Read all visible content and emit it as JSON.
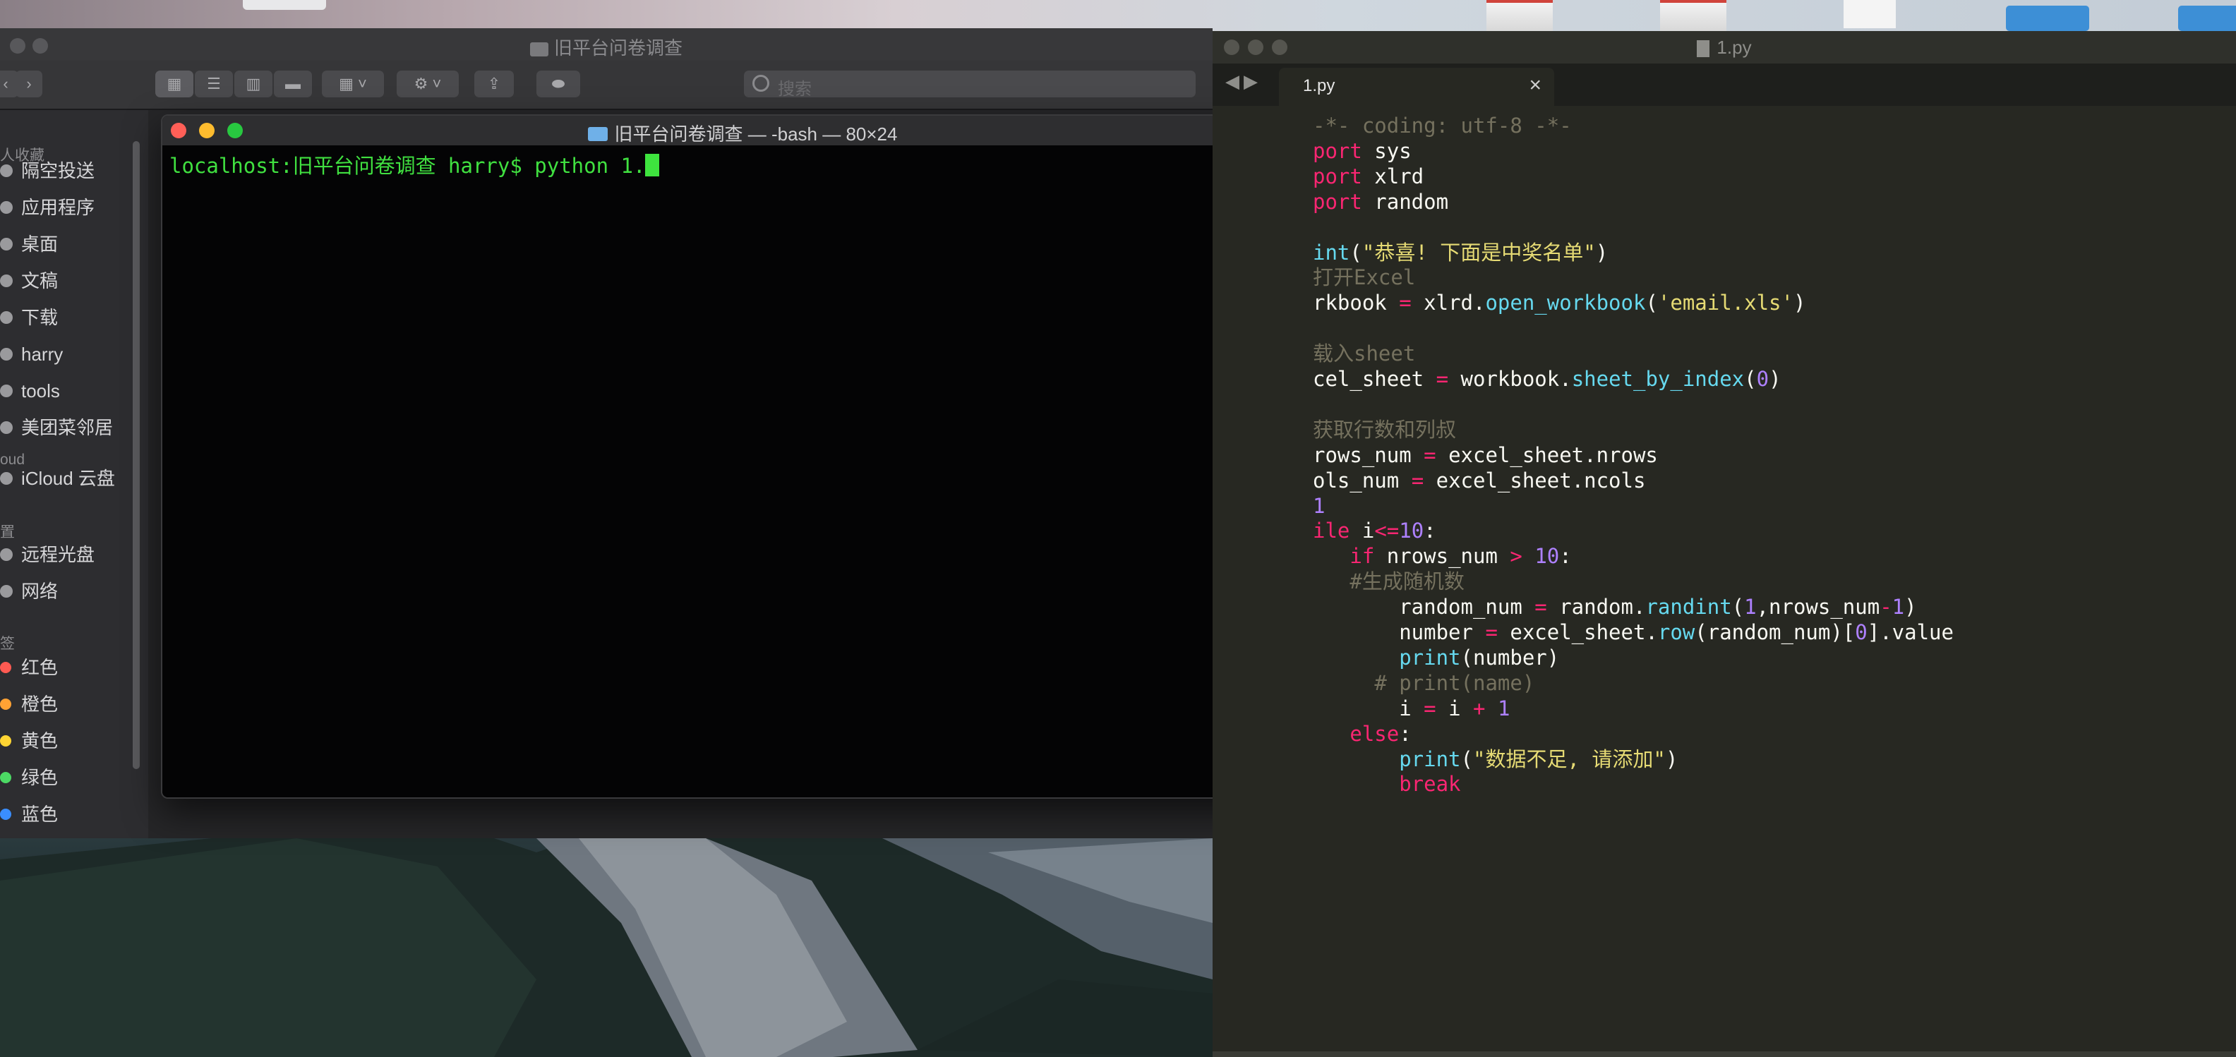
{
  "finder": {
    "title": "旧平台问卷调查",
    "search_placeholder": "搜索",
    "sidebar": {
      "favorites_header": "人收藏",
      "items": [
        {
          "label": "隔空投送",
          "icon": "airdrop-icon"
        },
        {
          "label": "应用程序",
          "icon": "applications-icon"
        },
        {
          "label": "桌面",
          "icon": "desktop-folder-icon"
        },
        {
          "label": "文稿",
          "icon": "documents-icon"
        },
        {
          "label": "下载",
          "icon": "downloads-icon"
        },
        {
          "label": "harry",
          "icon": "home-icon"
        },
        {
          "label": "tools",
          "icon": "folder-icon"
        },
        {
          "label": "美团菜邻居",
          "icon": "folder-icon"
        }
      ],
      "icloud_header": "oud",
      "icloud_items": [
        {
          "label": "iCloud 云盘",
          "icon": "icloud-icon"
        }
      ],
      "devices_header": "置",
      "device_items": [
        {
          "label": "远程光盘",
          "icon": "disc-icon"
        },
        {
          "label": "网络",
          "icon": "network-icon"
        }
      ],
      "tags_header": "签",
      "tags": [
        {
          "label": "红色",
          "color": "#ff5a52"
        },
        {
          "label": "橙色",
          "color": "#ffa234"
        },
        {
          "label": "黄色",
          "color": "#ffd533"
        },
        {
          "label": "绿色",
          "color": "#4cd964"
        },
        {
          "label": "蓝色",
          "color": "#3a8eff"
        }
      ]
    }
  },
  "terminal": {
    "title": "旧平台问卷调查 — -bash — 80×24",
    "line": "localhost:旧平台问卷调查 harry$ python 1."
  },
  "editor": {
    "window_title": "1.py",
    "tab_label": "1.py",
    "lines": [
      [
        [
          "cmt",
          "-*- coding: utf-8 -*-"
        ]
      ],
      [
        [
          "kw",
          "port"
        ],
        [
          "txt",
          " sys"
        ]
      ],
      [
        [
          "kw",
          "port"
        ],
        [
          "txt",
          " xlrd"
        ]
      ],
      [
        [
          "kw",
          "port"
        ],
        [
          "txt",
          " random"
        ]
      ],
      [],
      [
        [
          "fn",
          "int"
        ],
        [
          "txt",
          "("
        ],
        [
          "str",
          "\"恭喜! 下面是中奖名单\""
        ],
        [
          "txt",
          ")"
        ]
      ],
      [
        [
          "cmt",
          "打开Excel"
        ]
      ],
      [
        [
          "txt",
          "rkbook "
        ],
        [
          "op",
          "="
        ],
        [
          "txt",
          " xlrd."
        ],
        [
          "fn",
          "open_workbook"
        ],
        [
          "txt",
          "("
        ],
        [
          "str",
          "'email.xls'"
        ],
        [
          "txt",
          ")"
        ]
      ],
      [],
      [
        [
          "cmt",
          "载入sheet"
        ]
      ],
      [
        [
          "txt",
          "cel_sheet "
        ],
        [
          "op",
          "="
        ],
        [
          "txt",
          " workbook."
        ],
        [
          "fn",
          "sheet_by_index"
        ],
        [
          "txt",
          "("
        ],
        [
          "num",
          "0"
        ],
        [
          "txt",
          ")"
        ]
      ],
      [],
      [
        [
          "cmt",
          "获取行数和列叔"
        ]
      ],
      [
        [
          "txt",
          "rows_num "
        ],
        [
          "op",
          "="
        ],
        [
          "txt",
          " excel_sheet.nrows"
        ]
      ],
      [
        [
          "txt",
          "ols_num "
        ],
        [
          "op",
          "="
        ],
        [
          "txt",
          " excel_sheet.ncols"
        ]
      ],
      [
        [
          "num",
          "1"
        ]
      ],
      [
        [
          "kw",
          "ile"
        ],
        [
          "txt",
          " i"
        ],
        [
          "op",
          "<="
        ],
        [
          "num",
          "10"
        ],
        [
          "txt",
          ":"
        ]
      ],
      [
        [
          "txt",
          "   "
        ],
        [
          "kw",
          "if"
        ],
        [
          "txt",
          " nrows_num "
        ],
        [
          "op",
          ">"
        ],
        [
          "txt",
          " "
        ],
        [
          "num",
          "10"
        ],
        [
          "txt",
          ":"
        ]
      ],
      [
        [
          "txt",
          "   "
        ],
        [
          "cmt",
          "#生成随机数"
        ]
      ],
      [
        [
          "txt",
          "       random_num "
        ],
        [
          "op",
          "="
        ],
        [
          "txt",
          " random."
        ],
        [
          "fn",
          "randint"
        ],
        [
          "txt",
          "("
        ],
        [
          "num",
          "1"
        ],
        [
          "txt",
          ",nrows_num"
        ],
        [
          "op",
          "-"
        ],
        [
          "num",
          "1"
        ],
        [
          "txt",
          ")"
        ]
      ],
      [
        [
          "txt",
          "       number "
        ],
        [
          "op",
          "="
        ],
        [
          "txt",
          " excel_sheet."
        ],
        [
          "fn",
          "row"
        ],
        [
          "txt",
          "(random_num)["
        ],
        [
          "num",
          "0"
        ],
        [
          "txt",
          "].value"
        ]
      ],
      [
        [
          "txt",
          "       "
        ],
        [
          "fn",
          "print"
        ],
        [
          "txt",
          "(number)"
        ]
      ],
      [
        [
          "txt",
          "     "
        ],
        [
          "cmt",
          "# print(name)"
        ]
      ],
      [
        [
          "txt",
          "       i "
        ],
        [
          "op",
          "="
        ],
        [
          "txt",
          " i "
        ],
        [
          "op",
          "+"
        ],
        [
          "txt",
          " "
        ],
        [
          "num",
          "1"
        ]
      ],
      [
        [
          "txt",
          "   "
        ],
        [
          "kw",
          "else"
        ],
        [
          "txt",
          ":"
        ]
      ],
      [
        [
          "txt",
          "       "
        ],
        [
          "fn",
          "print"
        ],
        [
          "txt",
          "("
        ],
        [
          "str",
          "\"数据不足, 请添加\""
        ],
        [
          "txt",
          ")"
        ]
      ],
      [
        [
          "txt",
          "       "
        ],
        [
          "kw",
          "break"
        ]
      ]
    ]
  }
}
